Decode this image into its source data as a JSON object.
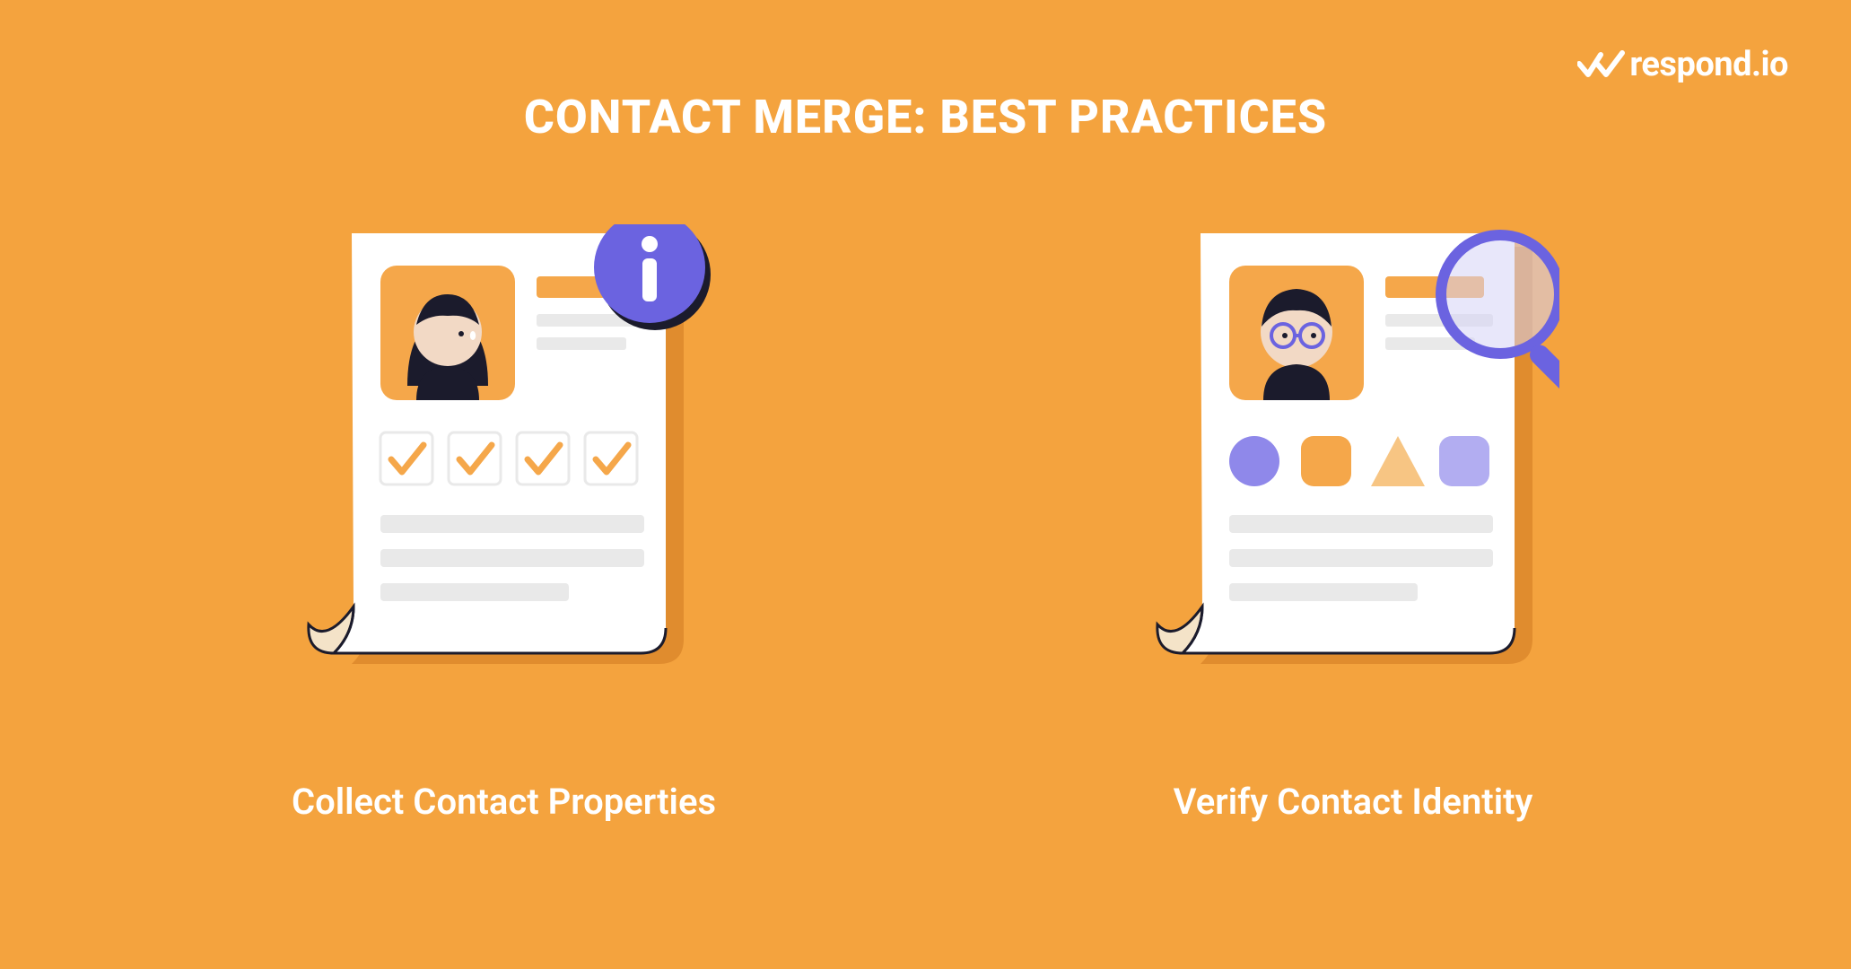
{
  "brand": {
    "name": "respond.io"
  },
  "title": "CONTACT MERGE: BEST PRACTICES",
  "cards": [
    {
      "caption": "Collect Contact Properties"
    },
    {
      "caption": "Verify Contact Identity"
    }
  ],
  "colors": {
    "bg": "#f4a33e",
    "accentPurple": "#6b63e0",
    "accentOrange": "#f5a74a",
    "dark": "#1b1b2c",
    "paper": "#ffffff",
    "lightGray": "#e9e9e9",
    "skin": "#f2d9c5"
  }
}
